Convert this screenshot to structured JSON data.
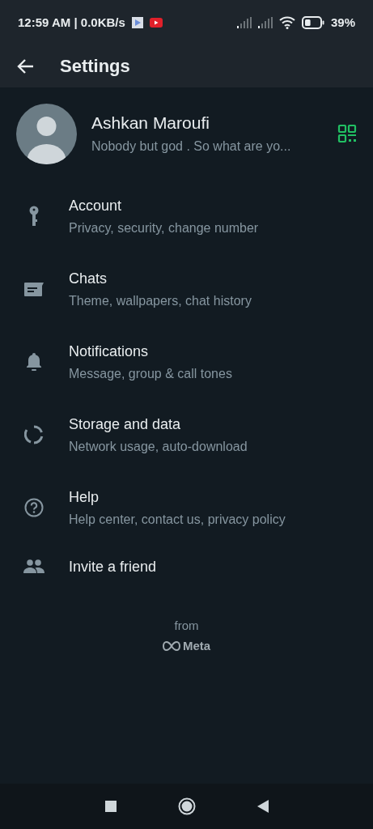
{
  "status_bar": {
    "time": "12:59 AM | 0.0KB/s",
    "battery": "39%"
  },
  "app_bar": {
    "title": "Settings"
  },
  "profile": {
    "name": "Ashkan Maroufi",
    "about": "Nobody but god . So what are yo..."
  },
  "items": [
    {
      "title": "Account",
      "subtitle": "Privacy, security, change number"
    },
    {
      "title": "Chats",
      "subtitle": "Theme, wallpapers, chat history"
    },
    {
      "title": "Notifications",
      "subtitle": "Message, group & call tones"
    },
    {
      "title": "Storage and data",
      "subtitle": "Network usage, auto-download"
    },
    {
      "title": "Help",
      "subtitle": "Help center, contact us, privacy policy"
    },
    {
      "title": "Invite a friend"
    }
  ],
  "footer": {
    "from": "from",
    "brand": "Meta"
  }
}
